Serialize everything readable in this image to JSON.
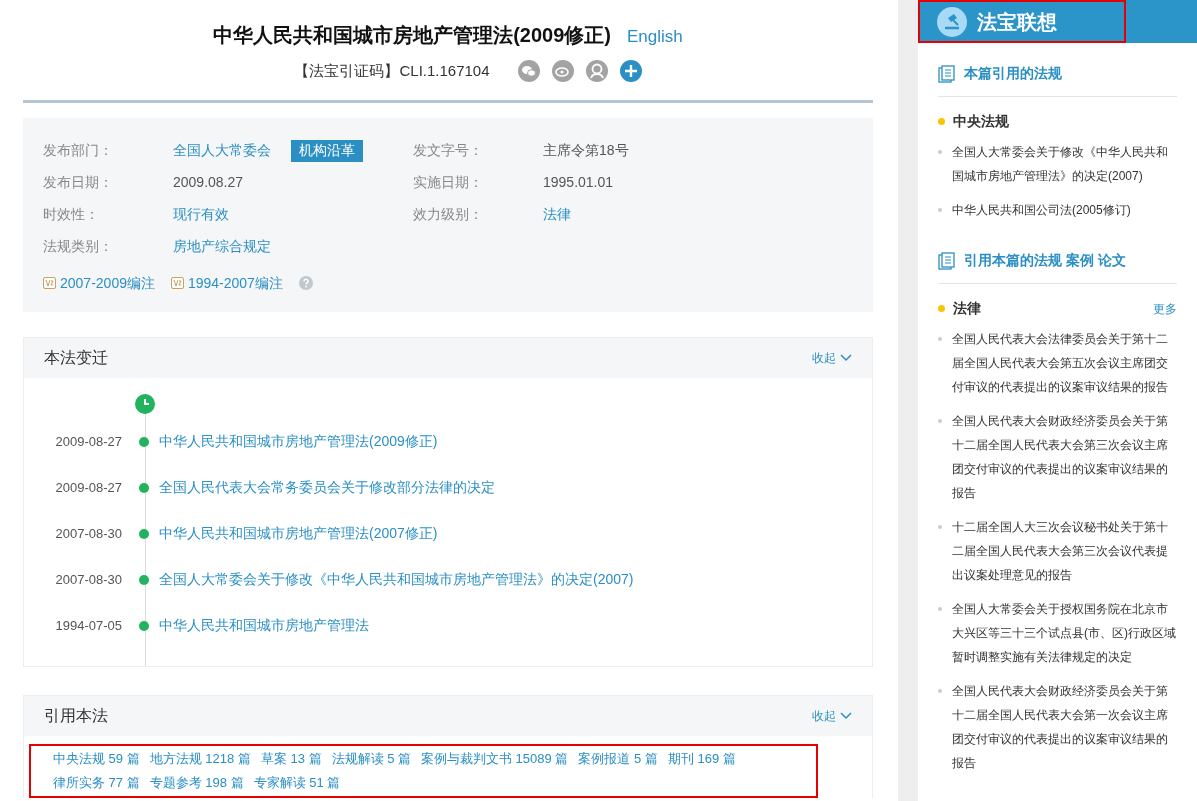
{
  "header": {
    "title": "中华人民共和国城市房地产管理法(2009修正)",
    "english_link": "English",
    "cite_code": "【法宝引证码】CLI.1.167104"
  },
  "info": {
    "fields": [
      {
        "label": "发布部门：",
        "value": "全国人大常委会",
        "kind": "link",
        "button": "机构沿革"
      },
      {
        "label": "发文字号：",
        "value": "主席令第18号",
        "kind": "plain"
      },
      {
        "label": "发布日期：",
        "value": "2009.08.27",
        "kind": "plain"
      },
      {
        "label": "实施日期：",
        "value": "1995.01.01",
        "kind": "plain"
      },
      {
        "label": "时效性：",
        "value": "现行有效",
        "kind": "link"
      },
      {
        "label": "效力级别：",
        "value": "法律",
        "kind": "link"
      },
      {
        "label": "法规类别：",
        "value": "房地产综合规定",
        "kind": "link"
      }
    ],
    "annotations": [
      "2007-2009编注",
      "1994-2007编注"
    ]
  },
  "history": {
    "title": "本法变迁",
    "toggle": "收起",
    "items": [
      {
        "date": "2009-08-27",
        "title": "中华人民共和国城市房地产管理法(2009修正)"
      },
      {
        "date": "2009-08-27",
        "title": "全国人民代表大会常务委员会关于修改部分法律的决定"
      },
      {
        "date": "2007-08-30",
        "title": "中华人民共和国城市房地产管理法(2007修正)"
      },
      {
        "date": "2007-08-30",
        "title": "全国人大常委会关于修改《中华人民共和国城市房地产管理法》的决定(2007)"
      },
      {
        "date": "1994-07-05",
        "title": "中华人民共和国城市房地产管理法"
      }
    ]
  },
  "citing": {
    "title": "引用本法",
    "toggle": "收起",
    "links": [
      "中央法规 59 篇",
      "地方法规 1218 篇",
      "草案 13 篇",
      "法规解读 5 篇",
      "案例与裁判文书 15089 篇",
      "案例报道 5 篇",
      "期刊 169 篇",
      "律所实务 77 篇",
      "专题参考 198 篇",
      "专家解读 51 篇"
    ]
  },
  "sidebar": {
    "title": "法宝联想",
    "sections": [
      {
        "title": "本篇引用的法规",
        "groups": [
          {
            "name": "中央法规",
            "items": [
              "全国人大常委会关于修改《中华人民共和国城市房地产管理法》的决定(2007)",
              "中华人民共和国公司法(2005修订)"
            ]
          }
        ]
      },
      {
        "title": "引用本篇的法规 案例 论文",
        "groups": [
          {
            "name": "法律",
            "more": "更多",
            "items": [
              "全国人民代表大会法律委员会关于第十二届全国人民代表大会第五次会议主席团交付审议的代表提出的议案审议结果的报告",
              "全国人民代表大会财政经济委员会关于第十二届全国人民代表大会第三次会议主席团交付审议的代表提出的议案审议结果的报告",
              "十二届全国人大三次会议秘书处关于第十二届全国人民代表大会第三次会议代表提出议案处理意见的报告",
              "全国人大常委会关于授权国务院在北京市大兴区等三十三个试点县(市、区)行政区域暂时调整实施有关法律规定的决定",
              "全国人民代表大会财政经济委员会关于第十二届全国人民代表大会第一次会议主席团交付审议的代表提出的议案审议结果的报告"
            ]
          }
        ]
      }
    ]
  }
}
